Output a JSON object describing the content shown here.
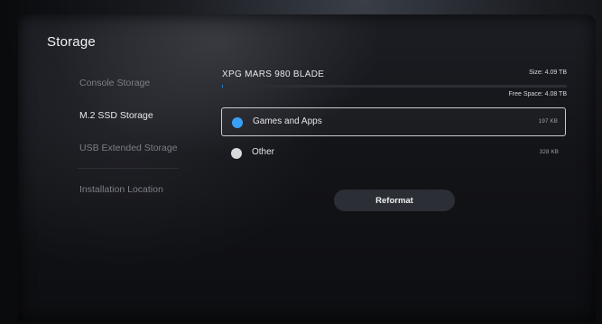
{
  "page": {
    "title": "Storage"
  },
  "sidebar": {
    "items": [
      {
        "label": "Console Storage"
      },
      {
        "label": "M.2 SSD Storage"
      },
      {
        "label": "USB Extended Storage"
      },
      {
        "label": "Installation Location"
      }
    ]
  },
  "drive": {
    "name": "XPG MARS 980 BLADE",
    "size": "Size: 4.09 TB",
    "free_space": "Free Space: 4.08 TB",
    "usage_fraction": 0.0025,
    "accent_color": "#1f8cf0"
  },
  "categories": [
    {
      "label": "Games and Apps",
      "size": "197 KB",
      "color": "#3aa0f5"
    },
    {
      "label": "Other",
      "size": "328 KB",
      "color": "#d9d9dc"
    }
  ],
  "actions": {
    "reformat_label": "Reformat"
  }
}
